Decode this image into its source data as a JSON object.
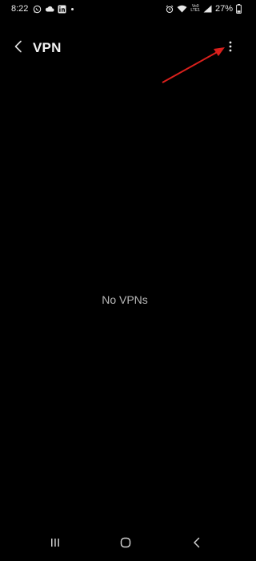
{
  "status_bar": {
    "time": "8:22",
    "battery_percent": "27%",
    "network_label_top": "Vo0",
    "network_label_bottom": "LTE1",
    "icons": [
      "whatsapp-icon",
      "cloud-icon",
      "linkedin-icon",
      "dot-icon",
      "alarm-icon",
      "wifi-icon",
      "signal-icon",
      "battery-icon"
    ]
  },
  "app_bar": {
    "title": "VPN",
    "back_icon": "chevron-left-icon",
    "more_icon": "more-vertical-icon"
  },
  "annotation": {
    "arrow_color": "#d9201c"
  },
  "content": {
    "empty_message": "No VPNs"
  },
  "nav_bar": {
    "icons": [
      "recents-icon",
      "home-icon",
      "back-icon"
    ]
  }
}
